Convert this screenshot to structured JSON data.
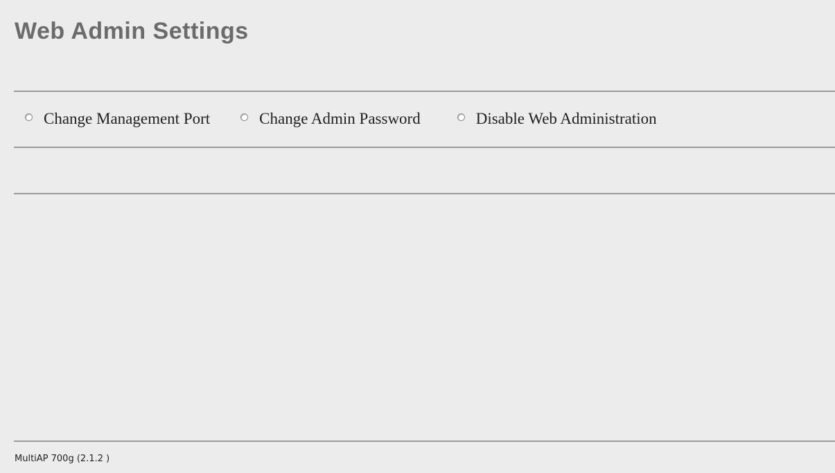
{
  "header": {
    "title": "Web Admin Settings"
  },
  "options": [
    {
      "label": "Change Management Port",
      "selected": false
    },
    {
      "label": "Change Admin Password",
      "selected": false
    },
    {
      "label": "Disable Web Administration",
      "selected": false
    }
  ],
  "footer": {
    "version_text": "MultiAP 700g (2.1.2 )"
  },
  "colors": {
    "background": "#ececec",
    "title": "#6b6b6b",
    "divider": "#9a9a9a"
  }
}
